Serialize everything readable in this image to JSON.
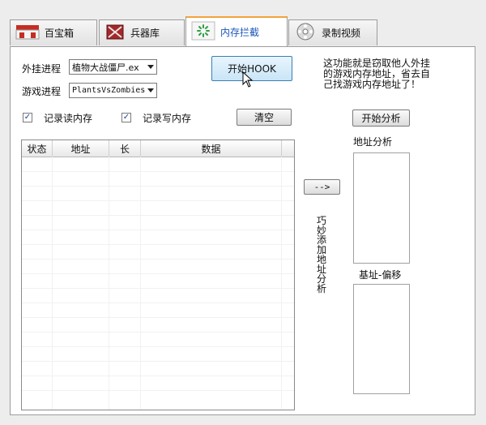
{
  "tabs": [
    {
      "label": "百宝箱",
      "icon": "treasure-chest-icon"
    },
    {
      "label": "兵器库",
      "icon": "weapon-icon"
    },
    {
      "label": "内存拦截",
      "icon": "loading-spinner-icon"
    },
    {
      "label": "录制视频",
      "icon": "video-reel-icon"
    }
  ],
  "form": {
    "plugin_process_label": "外挂进程",
    "plugin_process_value": "植物大战僵尸.ex",
    "game_process_label": "游戏进程",
    "game_process_value": "PlantsVsZombies",
    "record_read_label": "记录读内存",
    "record_write_label": "记录写内存",
    "record_read_checked": true,
    "record_write_checked": true
  },
  "buttons": {
    "start_hook": "开始HOOK",
    "clear": "清空",
    "start_analysis": "开始分析",
    "arrow": "-->"
  },
  "description": "这功能就是窃取他人外挂的游戏内存地址，省去自己找游戏内存地址了！",
  "table": {
    "columns": [
      "状态",
      "地址",
      "长",
      "数据"
    ]
  },
  "right_panel": {
    "address_analysis_label": "地址分析",
    "base_offset_label": "基址-偏移",
    "smart_add_label": "巧妙添加地址分析"
  }
}
